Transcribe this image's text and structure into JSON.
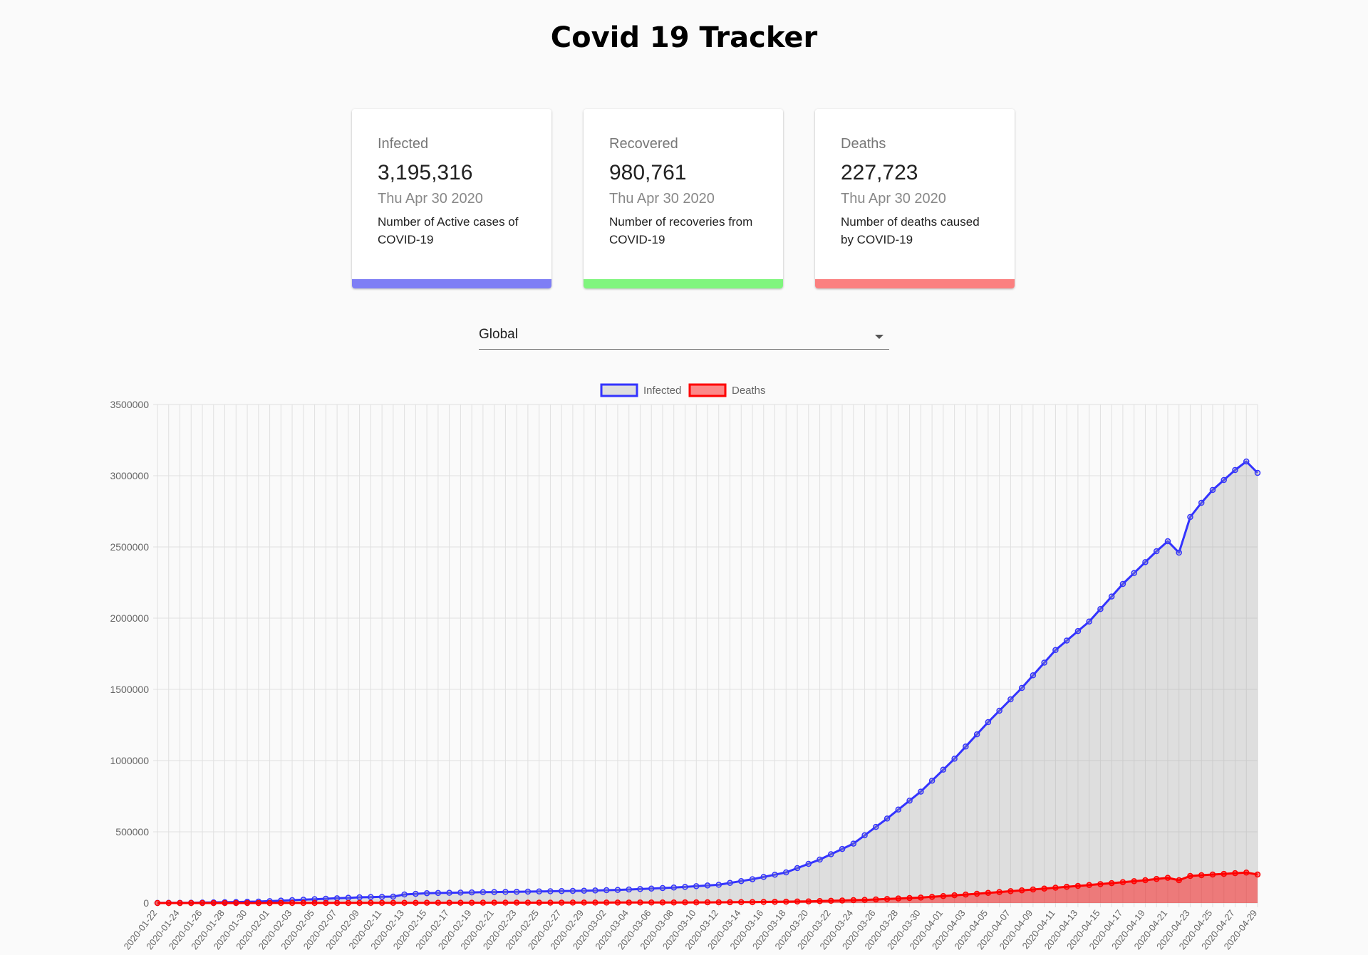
{
  "title": "Covid 19 Tracker",
  "cards": [
    {
      "label": "Infected",
      "value": "3,195,316",
      "date": "Thu Apr 30 2020",
      "description": "Number of Active cases of COVID-19",
      "color": "#7e7ef5"
    },
    {
      "label": "Recovered",
      "value": "980,761",
      "date": "Thu Apr 30 2020",
      "description": "Number of recoveries from COVID-19",
      "color": "#80f57e"
    },
    {
      "label": "Deaths",
      "value": "227,723",
      "date": "Thu Apr 30 2020",
      "description": "Number of deaths caused by COVID-19",
      "color": "#fb8080"
    }
  ],
  "country_select": {
    "selected": "Global"
  },
  "chart_data": {
    "type": "line",
    "title": "",
    "xlabel": "",
    "ylabel": "",
    "ylim": [
      0,
      3500000
    ],
    "yticks": [
      0,
      500000,
      1000000,
      1500000,
      2000000,
      2500000,
      3000000,
      3500000
    ],
    "grid": true,
    "legend_position": "top",
    "x_start": "2020-01-22",
    "x_end": "2020-04-29",
    "series": [
      {
        "name": "Infected",
        "line_color": "#3333ff",
        "fill_color": "rgba(160,160,160,0.30)",
        "anchors": [
          [
            "2020-01-22",
            555
          ],
          [
            "2020-01-25",
            2000
          ],
          [
            "2020-01-28",
            5600
          ],
          [
            "2020-01-31",
            9900
          ],
          [
            "2020-02-03",
            20000
          ],
          [
            "2020-02-06",
            30000
          ],
          [
            "2020-02-09",
            40000
          ],
          [
            "2020-02-12",
            45000
          ],
          [
            "2020-02-13",
            60000
          ],
          [
            "2020-02-15",
            69000
          ],
          [
            "2020-02-20",
            76000
          ],
          [
            "2020-02-25",
            81000
          ],
          [
            "2020-02-29",
            86000
          ],
          [
            "2020-03-03",
            92000
          ],
          [
            "2020-03-06",
            101000
          ],
          [
            "2020-03-09",
            113000
          ],
          [
            "2020-03-12",
            128000
          ],
          [
            "2020-03-15",
            167000
          ],
          [
            "2020-03-18",
            215000
          ],
          [
            "2020-03-21",
            305000
          ],
          [
            "2020-03-24",
            417000
          ],
          [
            "2020-03-27",
            593000
          ],
          [
            "2020-03-30",
            782000
          ],
          [
            "2020-04-02",
            1013000
          ],
          [
            "2020-04-05",
            1270000
          ],
          [
            "2020-04-08",
            1510000
          ],
          [
            "2020-04-11",
            1776000
          ],
          [
            "2020-04-14",
            1976000
          ],
          [
            "2020-04-17",
            2240000
          ],
          [
            "2020-04-20",
            2470000
          ],
          [
            "2020-04-21",
            2540000
          ],
          [
            "2020-04-22",
            2460000
          ],
          [
            "2020-04-23",
            2710000
          ],
          [
            "2020-04-24",
            2810000
          ],
          [
            "2020-04-25",
            2900000
          ],
          [
            "2020-04-26",
            2970000
          ],
          [
            "2020-04-27",
            3040000
          ],
          [
            "2020-04-28",
            3100000
          ],
          [
            "2020-04-29",
            3020000
          ]
        ]
      },
      {
        "name": "Deaths",
        "line_color": "#ff0000",
        "fill_color": "rgba(255,0,0,0.45)",
        "anchors": [
          [
            "2020-01-22",
            17
          ],
          [
            "2020-02-01",
            259
          ],
          [
            "2020-02-10",
            1000
          ],
          [
            "2020-02-20",
            2200
          ],
          [
            "2020-03-01",
            3000
          ],
          [
            "2020-03-10",
            4300
          ],
          [
            "2020-03-15",
            6500
          ],
          [
            "2020-03-20",
            11300
          ],
          [
            "2020-03-25",
            22000
          ],
          [
            "2020-03-30",
            38000
          ],
          [
            "2020-04-04",
            65000
          ],
          [
            "2020-04-09",
            95000
          ],
          [
            "2020-04-14",
            126000
          ],
          [
            "2020-04-19",
            160000
          ],
          [
            "2020-04-21",
            177000
          ],
          [
            "2020-04-22",
            160000
          ],
          [
            "2020-04-23",
            190000
          ],
          [
            "2020-04-25",
            200000
          ],
          [
            "2020-04-28",
            214000
          ],
          [
            "2020-04-29",
            200000
          ]
        ]
      }
    ]
  }
}
